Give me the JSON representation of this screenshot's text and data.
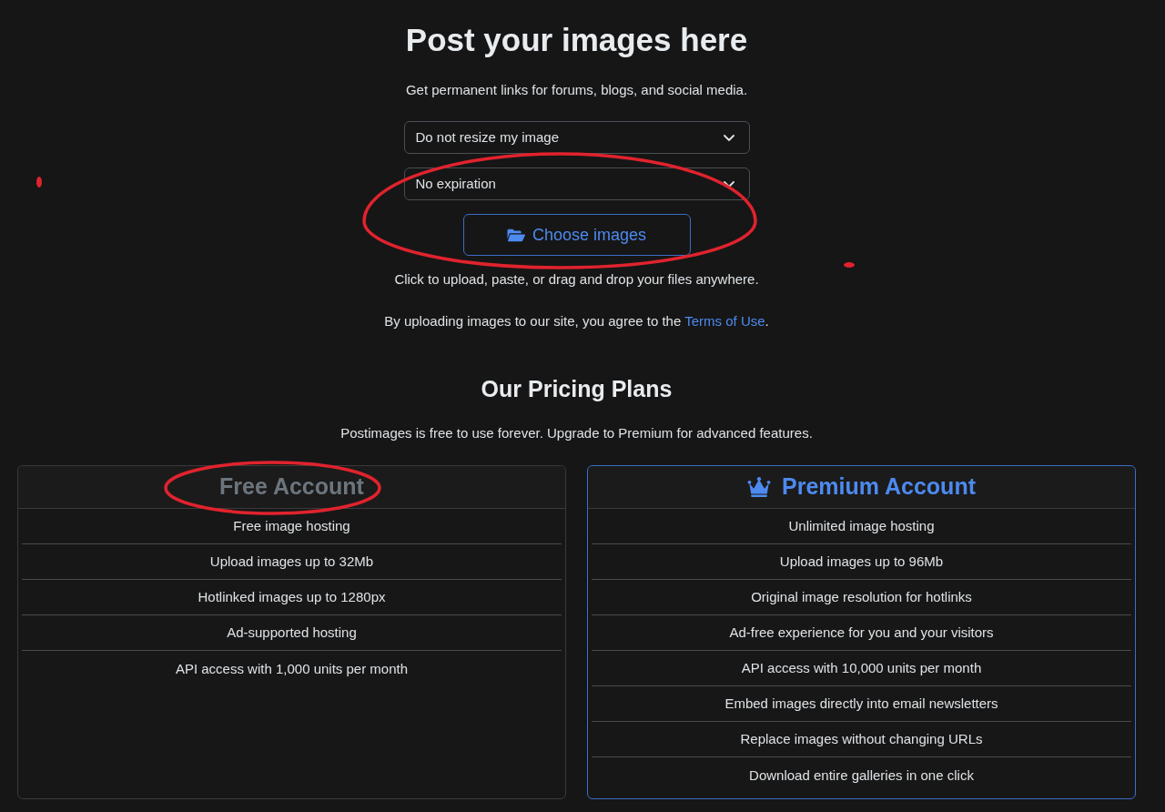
{
  "header": {
    "title": "Post your images here",
    "subtitle": "Get permanent links for forums, blogs, and social media."
  },
  "upload_form": {
    "selects": [
      {
        "value": "Do not resize my image"
      },
      {
        "value": "No expiration"
      }
    ],
    "choose_button": {
      "label": "Choose images",
      "circled": true
    },
    "hint": "Click to upload, paste, or drag and drop your files anywhere.",
    "terms": {
      "text": "By uploading images to our site, you agree to the ",
      "link": "Terms of Use",
      "after": "."
    }
  },
  "pricing": {
    "title": "Our Pricing Plans",
    "subtitle": "Postimages is free to use forever. Upgrade to Premium for advanced features.",
    "plans": [
      {
        "kind": "free",
        "title": "Free Account",
        "title_circled": true,
        "features": [
          "Free image hosting",
          "Upload images up to 32Mb",
          "Hotlinked images up to 1280px",
          "Ad-supported hosting",
          "API access with 1,000 units per month"
        ]
      },
      {
        "kind": "premium",
        "title": "Premium Account",
        "title_circled": false,
        "features": [
          "Unlimited image hosting",
          "Upload images up to 96Mb",
          "Original image resolution for hotlinks",
          "Ad-free experience for you and your visitors",
          "API access with 10,000 units per month",
          "Embed images directly into email newsletters",
          "Replace images without changing URLs",
          "Download entire galleries in one click"
        ]
      }
    ]
  },
  "annotation_marks": [
    {
      "kind": "dot"
    },
    {
      "kind": "dot"
    }
  ]
}
